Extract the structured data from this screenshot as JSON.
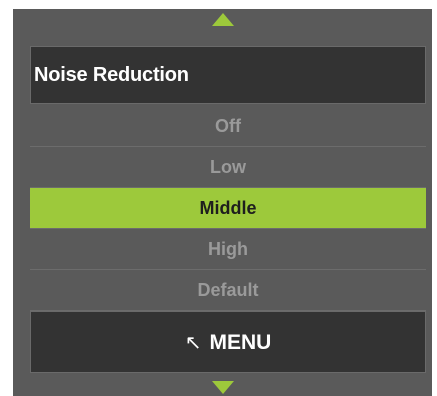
{
  "dialog": {
    "title": "Noise Reduction",
    "options": [
      {
        "label": "Off",
        "selected": false
      },
      {
        "label": "Low",
        "selected": false
      },
      {
        "label": "Middle",
        "selected": true
      },
      {
        "label": "High",
        "selected": false
      },
      {
        "label": "Default",
        "selected": false
      }
    ],
    "menu_label": "MENU",
    "menu_icon": "↖",
    "scroll_up_icon": "triangle-up-icon",
    "scroll_down_icon": "triangle-down-icon"
  },
  "colors": {
    "panel_background": "#5a5a5a",
    "bar_background": "#333333",
    "accent": "#9dc93b",
    "option_text": "#9a9a9a",
    "selected_text": "#1e1e1e"
  }
}
